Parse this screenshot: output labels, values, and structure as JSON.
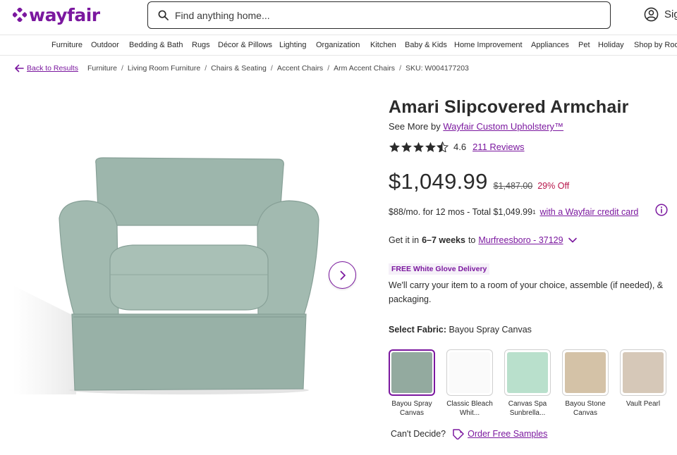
{
  "header": {
    "logo_text": "wayfair",
    "search_placeholder": "Find anything home...",
    "account_label": "Sig"
  },
  "nav": {
    "items": [
      "Furniture",
      "Outdoor",
      "Bedding & Bath",
      "Rugs",
      "Décor & Pillows",
      "Lighting",
      "Organization",
      "Kitchen",
      "Baby & Kids",
      "Home Improvement",
      "Appliances",
      "Pet",
      "Holiday",
      "Shop by Roo"
    ]
  },
  "breadcrumb": {
    "back_label": "Back to Results",
    "items": [
      "Furniture",
      "Living Room Furniture",
      "Chairs & Seating",
      "Accent Chairs",
      "Arm Accent Chairs",
      "SKU: W004177203"
    ]
  },
  "product": {
    "title": "Amari Slipcovered Armchair",
    "see_more_prefix": "See More by",
    "brand": "Wayfair Custom Upholstery™",
    "rating": 4.6,
    "rating_text": "4.6",
    "reviews_label": "211 Reviews",
    "price": "$1,049.99",
    "original_price": "$1,487.00",
    "discount": "29% Off",
    "financing_text": "$88/mo. for 12 mos - Total $1,049.99",
    "financing_sup": "1",
    "financing_link": "with a Wayfair credit card",
    "delivery_prefix": "Get it in",
    "delivery_time": "6–7 weeks",
    "delivery_to": "to",
    "delivery_location": "Murfreesboro - 37129",
    "badge": "FREE White Glove Delivery",
    "glove_text": "We'll carry your item to a room of your choice, assemble (if needed), & packaging.",
    "select_fabric_label": "Select Fabric:",
    "selected_fabric": "Bayou Spray Canvas",
    "swatches": [
      {
        "label": "Bayou Spray Canvas",
        "color": "#93aa9f",
        "selected": true
      },
      {
        "label": "Classic Bleach Whit...",
        "color": "#fafafa",
        "selected": false
      },
      {
        "label": "Canvas Spa Sunbrella...",
        "color": "#b9e0cc",
        "selected": false
      },
      {
        "label": "Bayou Stone Canvas",
        "color": "#d4c2a7",
        "selected": false
      },
      {
        "label": "Vault Pearl",
        "color": "#d6c8b8",
        "selected": false
      }
    ],
    "cant_decide": "Can't Decide?",
    "samples_link": "Order Free Samples"
  },
  "colors": {
    "brand": "#7b189f",
    "discount": "#b7154a",
    "chair": "#9cb5ab"
  }
}
